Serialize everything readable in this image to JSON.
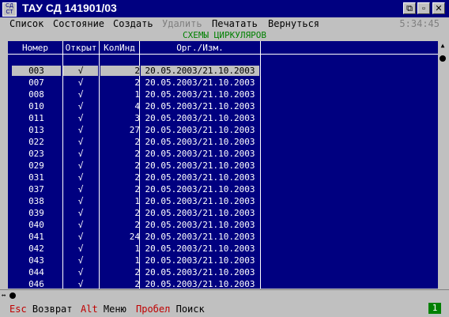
{
  "window": {
    "title": "ТАУ СД 141901/03",
    "icon": "app-icon",
    "controls": [
      "restore-icon",
      "minimize-icon",
      "close-icon"
    ]
  },
  "menu": {
    "items": [
      {
        "label": "Список",
        "enabled": true
      },
      {
        "label": "Состояние",
        "enabled": true
      },
      {
        "label": "Создать",
        "enabled": true
      },
      {
        "label": "Удалить",
        "enabled": false
      },
      {
        "label": "Печатать",
        "enabled": true
      },
      {
        "label": "Вернуться",
        "enabled": true
      }
    ],
    "clock": "5:34:45"
  },
  "subtitle": "СХЕМЫ ЦИРКУЛЯРОВ",
  "table": {
    "columns": [
      "Номер",
      "Открыт",
      "КолИнд",
      "Орг./Изм."
    ],
    "selected_index": 0,
    "rows": [
      {
        "num": "003",
        "open": "√",
        "cnt": "2",
        "date": "20.05.2003/21.10.2003"
      },
      {
        "num": "007",
        "open": "√",
        "cnt": "2",
        "date": "20.05.2003/21.10.2003"
      },
      {
        "num": "008",
        "open": "√",
        "cnt": "1",
        "date": "20.05.2003/21.10.2003"
      },
      {
        "num": "010",
        "open": "√",
        "cnt": "4",
        "date": "20.05.2003/21.10.2003"
      },
      {
        "num": "011",
        "open": "√",
        "cnt": "3",
        "date": "20.05.2003/21.10.2003"
      },
      {
        "num": "013",
        "open": "√",
        "cnt": "27",
        "date": "20.05.2003/21.10.2003"
      },
      {
        "num": "022",
        "open": "√",
        "cnt": "2",
        "date": "20.05.2003/21.10.2003"
      },
      {
        "num": "023",
        "open": "√",
        "cnt": "2",
        "date": "20.05.2003/21.10.2003"
      },
      {
        "num": "029",
        "open": "√",
        "cnt": "2",
        "date": "20.05.2003/21.10.2003"
      },
      {
        "num": "031",
        "open": "√",
        "cnt": "2",
        "date": "20.05.2003/21.10.2003"
      },
      {
        "num": "037",
        "open": "√",
        "cnt": "2",
        "date": "20.05.2003/21.10.2003"
      },
      {
        "num": "038",
        "open": "√",
        "cnt": "1",
        "date": "20.05.2003/21.10.2003"
      },
      {
        "num": "039",
        "open": "√",
        "cnt": "2",
        "date": "20.05.2003/21.10.2003"
      },
      {
        "num": "040",
        "open": "√",
        "cnt": "2",
        "date": "20.05.2003/21.10.2003"
      },
      {
        "num": "041",
        "open": "√",
        "cnt": "24",
        "date": "20.05.2003/21.10.2003"
      },
      {
        "num": "042",
        "open": "√",
        "cnt": "1",
        "date": "20.05.2003/21.10.2003"
      },
      {
        "num": "043",
        "open": "√",
        "cnt": "1",
        "date": "20.05.2003/21.10.2003"
      },
      {
        "num": "044",
        "open": "√",
        "cnt": "2",
        "date": "20.05.2003/21.10.2003"
      },
      {
        "num": "046",
        "open": "√",
        "cnt": "2",
        "date": "20.05.2003/21.10.2003"
      }
    ]
  },
  "statusbar": {
    "hints": [
      {
        "key": "Esc",
        "label": "Возврат"
      },
      {
        "key": "Alt",
        "label": "Меню"
      },
      {
        "key": "Пробел",
        "label": "Поиск"
      }
    ],
    "page": "1"
  },
  "colors": {
    "titlebar": "#000080",
    "panel": "#000080",
    "subtitle_text": "#008000",
    "hint_key": "#c00000",
    "page_badge": "#008000"
  }
}
